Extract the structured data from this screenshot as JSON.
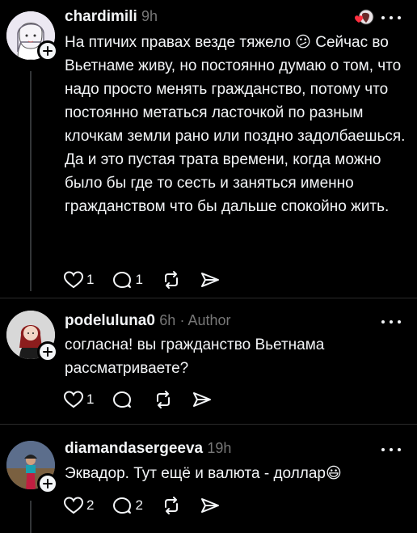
{
  "posts": [
    {
      "username": "chardimili",
      "time": "9h",
      "author_tag": "",
      "text": "На птичих правах везде тяжело 😕 Сейчас во Вьетнаме живу, но постоянно думаю о том, что надо просто менять гражданство, потому что постоянно метаться ласточкой по разным клочкам земли рано или поздно задолбаешься. Да и это пустая трата времени, когда можно было бы где то сесть и заняться именно гражданством что бы дальше спокойно жить.",
      "likes": "1",
      "replies": "1",
      "avatar_icon": "person-icon"
    },
    {
      "username": "podeluluna0",
      "time": "6h",
      "author_tag": "· Author",
      "text": "согласна! вы гражданство Вьетнама рассматриваете?",
      "likes": "1",
      "replies": "",
      "avatar_icon": "person-icon"
    },
    {
      "username": "diamandasergeeva",
      "time": "19h",
      "author_tag": "",
      "text": "Эквадор. Тут ещё и валюта - доллар😃",
      "likes": "2",
      "replies": "2",
      "avatar_icon": "person-icon"
    }
  ],
  "colors": {
    "background": "#000000",
    "text": "#f3f5f7",
    "muted": "#777777",
    "heart": "#ff3040"
  }
}
